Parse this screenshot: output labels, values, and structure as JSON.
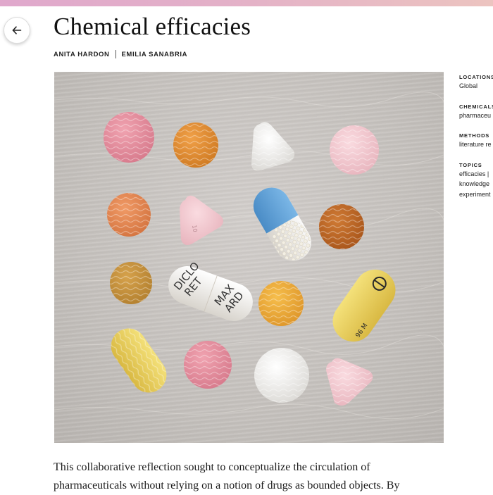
{
  "article": {
    "title": "Chemical efficacies",
    "authors": [
      "ANITA HARDON",
      "EMILIA SANABRIA"
    ],
    "body": [
      "This collaborative reflection sought to conceptualize the circulation of",
      "pharmaceuticals without relying on a notion of drugs as bounded objects. By"
    ]
  },
  "image": {
    "capsule_labels": {
      "diclo": [
        "DICLO",
        "RET",
        "MAX",
        "ARD"
      ],
      "yellow_right": "96 M"
    }
  },
  "sidebar": [
    {
      "label": "LOCATIONS",
      "values": [
        "Global"
      ]
    },
    {
      "label": "CHEMICALS",
      "values": [
        "pharmaceu"
      ]
    },
    {
      "label": "METHODS",
      "values": [
        "literature re"
      ]
    },
    {
      "label": "TOPICS",
      "values": [
        "efficacies |",
        "knowledge",
        "experiment"
      ]
    }
  ],
  "colors": {
    "accent_gradient": [
      "#e0a8cc",
      "#ecc4c0"
    ],
    "pill_pink": "#e38a9c",
    "pill_orange": "#e2892a",
    "pill_blue": "#5b9fd6",
    "pill_yellow": "#e7cd55"
  },
  "icons": {
    "back": "arrow-left-icon"
  }
}
